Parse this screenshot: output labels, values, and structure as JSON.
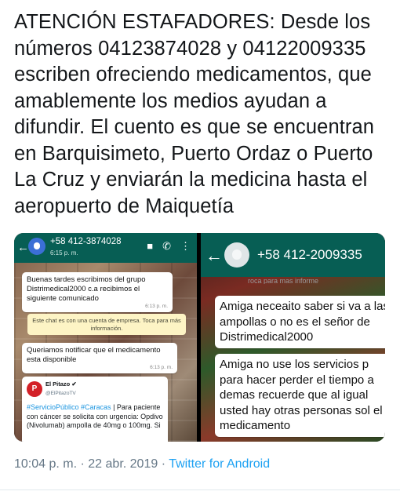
{
  "tweet": {
    "text": "ATENCIÓN ESTAFADORES: Desde los números 04123874028 y 04122009335 escriben ofreciendo medicamentos, que amablemente los medios ayudan a difundir. El cuento es que se encuentran en Barquisimeto, Puerto Ordaz o Puerto La Cruz y enviarán la medicina hasta el aeropuerto de Maiquetía",
    "time": "10:04 p. m.",
    "separator": "·",
    "date": "22 abr. 2019",
    "source": "Twitter for Android"
  },
  "screenshot_1": {
    "phone": "+58 412-3874028",
    "last_seen": "6:15 p. m.",
    "messages": [
      {
        "text": "Buenas tardes escribimos del grupo Distrimedical2000 c.a recibimos el siguiente comunicado",
        "time": "6:13 p. m."
      },
      {
        "text": "Queriamos notificar que el medicamento esta disponible",
        "time": "6:13 p. m."
      }
    ],
    "system_notice": "Este chat es con una cuenta de empresa. Toca para más información.",
    "embedded_tweet": {
      "logo": "P",
      "name": "El Pitazo ✔",
      "handle": "@ElPitazoTV",
      "hashtags": "#ServicioPúblico #Caracas",
      "body": " | Para paciente con cáncer se solicita con urgencia: Opdivo (Nivolumab) ampolla de 40mg o 100mg. Si"
    }
  },
  "screenshot_2": {
    "phone": "+58 412-2009335",
    "faded_text": "roca para mas informe",
    "messages": [
      {
        "text": "Amiga neceaito saber si va a las ampollas o no es el señor de Distrimedical2000"
      },
      {
        "text": "Amiga no use los servicios p para hacer perder el tiempo a demas recuerde que al igual usted hay otras personas sol el medicamento"
      }
    ]
  },
  "colors": {
    "whatsapp_header": "#075e54",
    "link": "#1da1f2",
    "meta_gray": "#657786"
  }
}
